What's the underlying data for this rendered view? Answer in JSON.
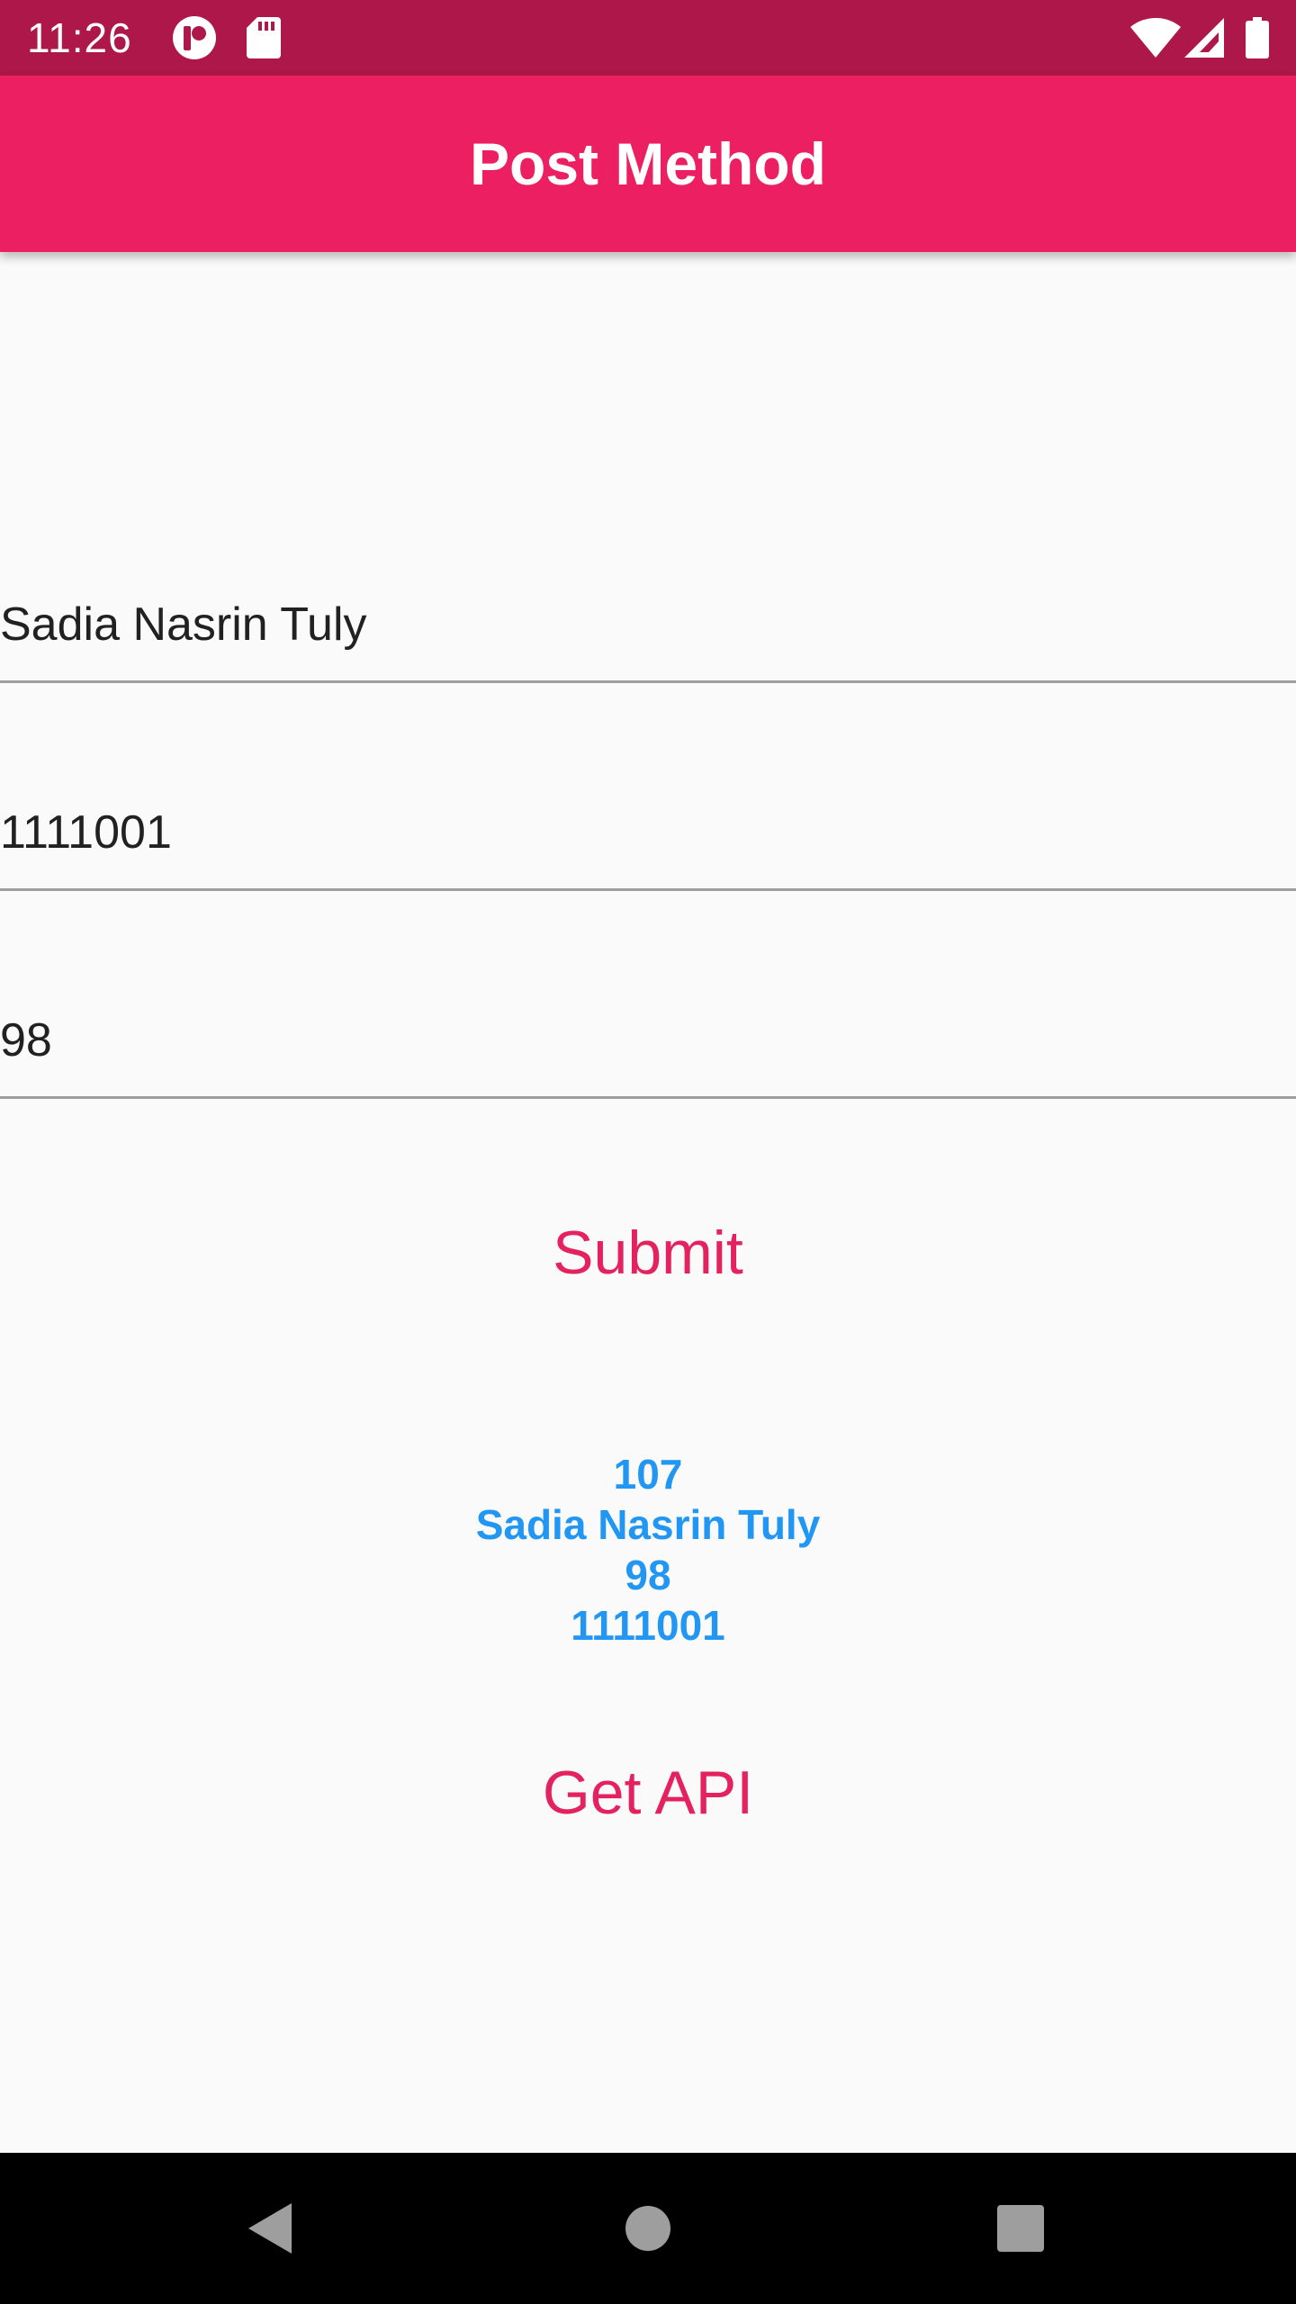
{
  "status_bar": {
    "time": "11:26",
    "icons": [
      "app-notification-icon",
      "sd-card-icon",
      "wifi-icon",
      "cellular-signal-icon",
      "battery-icon"
    ]
  },
  "app_bar": {
    "title": "Post Method"
  },
  "form": {
    "name_value": "Sadia Nasrin Tuly",
    "id_value": "1111001",
    "score_value": "98"
  },
  "buttons": {
    "submit_label": "Submit",
    "get_api_label": "Get API"
  },
  "result": {
    "id": "107",
    "name": "Sadia Nasrin Tuly",
    "score": "98",
    "code": "1111001"
  },
  "navigation": {
    "icons": [
      "back-icon",
      "home-icon",
      "recents-icon"
    ]
  },
  "colors": {
    "status_bar": "#AD1749",
    "app_bar": "#EC1F63",
    "button_text": "#E4225F",
    "result_text": "#2196F3",
    "background": "#FAFAFA"
  }
}
